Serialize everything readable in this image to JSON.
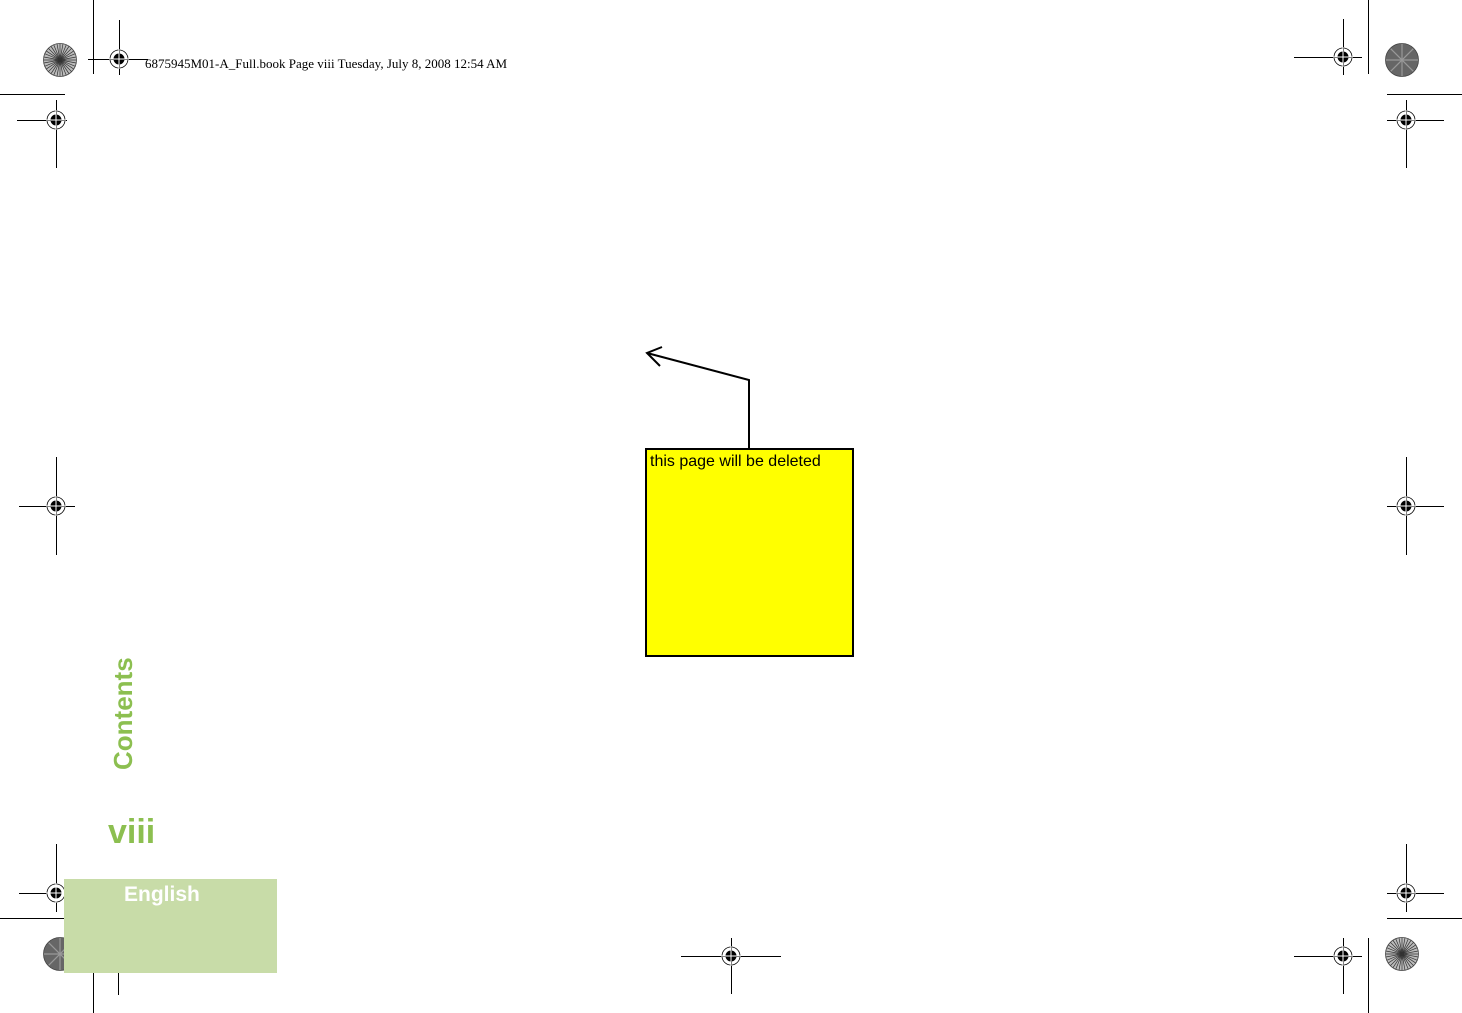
{
  "header": {
    "print_info": "6875945M01-A_Full.book  Page viii  Tuesday, July 8, 2008  12:54 AM"
  },
  "side": {
    "section_label": "Contents",
    "page_number": "viii",
    "language_tab": "English"
  },
  "annotation": {
    "note_text": "this page will be deleted",
    "note_color": "#ffff00"
  },
  "colors": {
    "accent_green": "#8cbf50",
    "tab_green": "#c8dca8"
  }
}
